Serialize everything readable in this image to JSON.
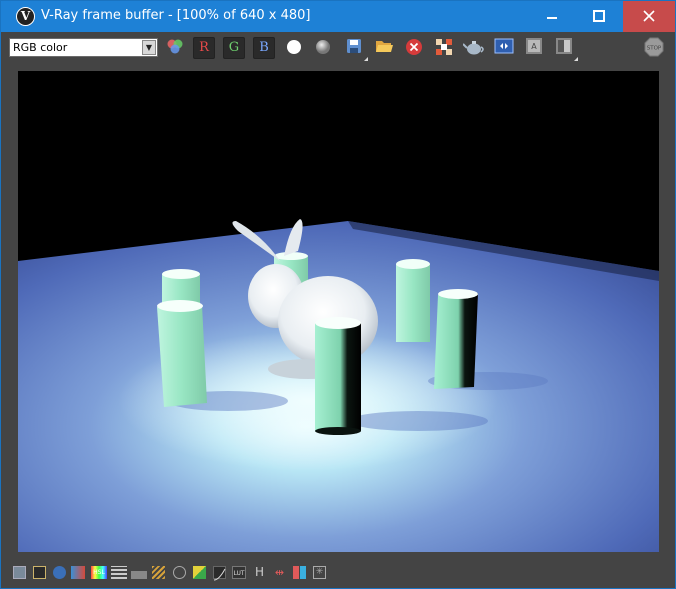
{
  "window": {
    "title": "V-Ray frame buffer - [100% of 640 x 480]"
  },
  "toolbar": {
    "channel_select": {
      "value": "RGB color"
    },
    "red_channel_label": "R",
    "green_channel_label": "G",
    "blue_channel_label": "B",
    "icons": [
      "color-circles-icon",
      "white-circle-icon",
      "grey-circle-icon",
      "save-icon",
      "folder-open-icon",
      "clear-image-icon",
      "region-render-icon",
      "teapot-render-icon",
      "lens-effects-icon",
      "compare-a-icon",
      "compare-b-icon",
      "stop-icon"
    ]
  },
  "bottom_bar": {
    "icons": [
      "folder-icon",
      "film-icon",
      "info-icon",
      "color-correct-icon",
      "hsl-icon",
      "levels-icon",
      "histogram-icon",
      "curves-icon",
      "exposure-icon",
      "white-balance-icon",
      "background-icon",
      "curve-icon",
      "lut-icon",
      "h-icon",
      "hilbert-icon",
      "sRGB-icon",
      "ocio-icon"
    ],
    "lut_label": "LUT",
    "hsl_label": "HSL",
    "h_label": "H"
  },
  "colors": {
    "titlebar": "#1e81d6",
    "close": "#c74b4b",
    "background": "#444444"
  }
}
